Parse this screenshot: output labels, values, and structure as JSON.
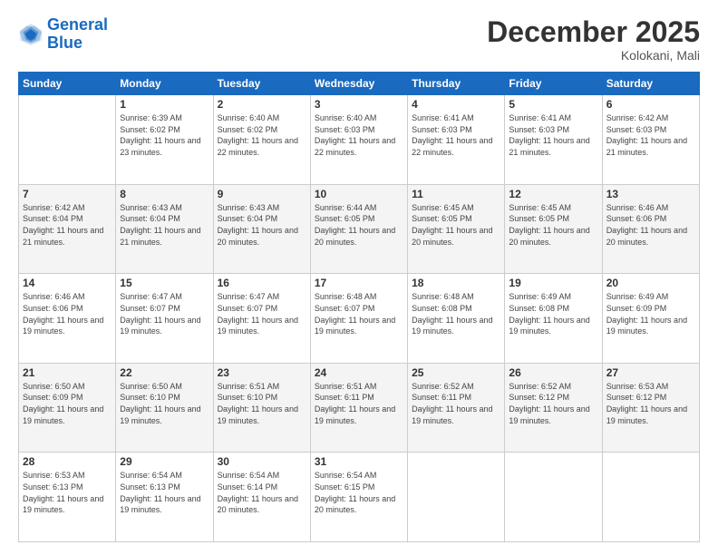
{
  "header": {
    "logo_line1": "General",
    "logo_line2": "Blue",
    "title": "December 2025",
    "subtitle": "Kolokani, Mali"
  },
  "weekdays": [
    "Sunday",
    "Monday",
    "Tuesday",
    "Wednesday",
    "Thursday",
    "Friday",
    "Saturday"
  ],
  "weeks": [
    [
      {
        "day": "",
        "sunrise": "",
        "sunset": "",
        "daylight": "",
        "empty": true
      },
      {
        "day": "1",
        "sunrise": "Sunrise: 6:39 AM",
        "sunset": "Sunset: 6:02 PM",
        "daylight": "Daylight: 11 hours and 23 minutes."
      },
      {
        "day": "2",
        "sunrise": "Sunrise: 6:40 AM",
        "sunset": "Sunset: 6:02 PM",
        "daylight": "Daylight: 11 hours and 22 minutes."
      },
      {
        "day": "3",
        "sunrise": "Sunrise: 6:40 AM",
        "sunset": "Sunset: 6:03 PM",
        "daylight": "Daylight: 11 hours and 22 minutes."
      },
      {
        "day": "4",
        "sunrise": "Sunrise: 6:41 AM",
        "sunset": "Sunset: 6:03 PM",
        "daylight": "Daylight: 11 hours and 22 minutes."
      },
      {
        "day": "5",
        "sunrise": "Sunrise: 6:41 AM",
        "sunset": "Sunset: 6:03 PM",
        "daylight": "Daylight: 11 hours and 21 minutes."
      },
      {
        "day": "6",
        "sunrise": "Sunrise: 6:42 AM",
        "sunset": "Sunset: 6:03 PM",
        "daylight": "Daylight: 11 hours and 21 minutes."
      }
    ],
    [
      {
        "day": "7",
        "sunrise": "Sunrise: 6:42 AM",
        "sunset": "Sunset: 6:04 PM",
        "daylight": "Daylight: 11 hours and 21 minutes."
      },
      {
        "day": "8",
        "sunrise": "Sunrise: 6:43 AM",
        "sunset": "Sunset: 6:04 PM",
        "daylight": "Daylight: 11 hours and 21 minutes."
      },
      {
        "day": "9",
        "sunrise": "Sunrise: 6:43 AM",
        "sunset": "Sunset: 6:04 PM",
        "daylight": "Daylight: 11 hours and 20 minutes."
      },
      {
        "day": "10",
        "sunrise": "Sunrise: 6:44 AM",
        "sunset": "Sunset: 6:05 PM",
        "daylight": "Daylight: 11 hours and 20 minutes."
      },
      {
        "day": "11",
        "sunrise": "Sunrise: 6:45 AM",
        "sunset": "Sunset: 6:05 PM",
        "daylight": "Daylight: 11 hours and 20 minutes."
      },
      {
        "day": "12",
        "sunrise": "Sunrise: 6:45 AM",
        "sunset": "Sunset: 6:05 PM",
        "daylight": "Daylight: 11 hours and 20 minutes."
      },
      {
        "day": "13",
        "sunrise": "Sunrise: 6:46 AM",
        "sunset": "Sunset: 6:06 PM",
        "daylight": "Daylight: 11 hours and 20 minutes."
      }
    ],
    [
      {
        "day": "14",
        "sunrise": "Sunrise: 6:46 AM",
        "sunset": "Sunset: 6:06 PM",
        "daylight": "Daylight: 11 hours and 19 minutes."
      },
      {
        "day": "15",
        "sunrise": "Sunrise: 6:47 AM",
        "sunset": "Sunset: 6:07 PM",
        "daylight": "Daylight: 11 hours and 19 minutes."
      },
      {
        "day": "16",
        "sunrise": "Sunrise: 6:47 AM",
        "sunset": "Sunset: 6:07 PM",
        "daylight": "Daylight: 11 hours and 19 minutes."
      },
      {
        "day": "17",
        "sunrise": "Sunrise: 6:48 AM",
        "sunset": "Sunset: 6:07 PM",
        "daylight": "Daylight: 11 hours and 19 minutes."
      },
      {
        "day": "18",
        "sunrise": "Sunrise: 6:48 AM",
        "sunset": "Sunset: 6:08 PM",
        "daylight": "Daylight: 11 hours and 19 minutes."
      },
      {
        "day": "19",
        "sunrise": "Sunrise: 6:49 AM",
        "sunset": "Sunset: 6:08 PM",
        "daylight": "Daylight: 11 hours and 19 minutes."
      },
      {
        "day": "20",
        "sunrise": "Sunrise: 6:49 AM",
        "sunset": "Sunset: 6:09 PM",
        "daylight": "Daylight: 11 hours and 19 minutes."
      }
    ],
    [
      {
        "day": "21",
        "sunrise": "Sunrise: 6:50 AM",
        "sunset": "Sunset: 6:09 PM",
        "daylight": "Daylight: 11 hours and 19 minutes."
      },
      {
        "day": "22",
        "sunrise": "Sunrise: 6:50 AM",
        "sunset": "Sunset: 6:10 PM",
        "daylight": "Daylight: 11 hours and 19 minutes."
      },
      {
        "day": "23",
        "sunrise": "Sunrise: 6:51 AM",
        "sunset": "Sunset: 6:10 PM",
        "daylight": "Daylight: 11 hours and 19 minutes."
      },
      {
        "day": "24",
        "sunrise": "Sunrise: 6:51 AM",
        "sunset": "Sunset: 6:11 PM",
        "daylight": "Daylight: 11 hours and 19 minutes."
      },
      {
        "day": "25",
        "sunrise": "Sunrise: 6:52 AM",
        "sunset": "Sunset: 6:11 PM",
        "daylight": "Daylight: 11 hours and 19 minutes."
      },
      {
        "day": "26",
        "sunrise": "Sunrise: 6:52 AM",
        "sunset": "Sunset: 6:12 PM",
        "daylight": "Daylight: 11 hours and 19 minutes."
      },
      {
        "day": "27",
        "sunrise": "Sunrise: 6:53 AM",
        "sunset": "Sunset: 6:12 PM",
        "daylight": "Daylight: 11 hours and 19 minutes."
      }
    ],
    [
      {
        "day": "28",
        "sunrise": "Sunrise: 6:53 AM",
        "sunset": "Sunset: 6:13 PM",
        "daylight": "Daylight: 11 hours and 19 minutes."
      },
      {
        "day": "29",
        "sunrise": "Sunrise: 6:54 AM",
        "sunset": "Sunset: 6:13 PM",
        "daylight": "Daylight: 11 hours and 19 minutes."
      },
      {
        "day": "30",
        "sunrise": "Sunrise: 6:54 AM",
        "sunset": "Sunset: 6:14 PM",
        "daylight": "Daylight: 11 hours and 20 minutes."
      },
      {
        "day": "31",
        "sunrise": "Sunrise: 6:54 AM",
        "sunset": "Sunset: 6:15 PM",
        "daylight": "Daylight: 11 hours and 20 minutes."
      },
      {
        "day": "",
        "sunrise": "",
        "sunset": "",
        "daylight": "",
        "empty": true
      },
      {
        "day": "",
        "sunrise": "",
        "sunset": "",
        "daylight": "",
        "empty": true
      },
      {
        "day": "",
        "sunrise": "",
        "sunset": "",
        "daylight": "",
        "empty": true
      }
    ]
  ]
}
